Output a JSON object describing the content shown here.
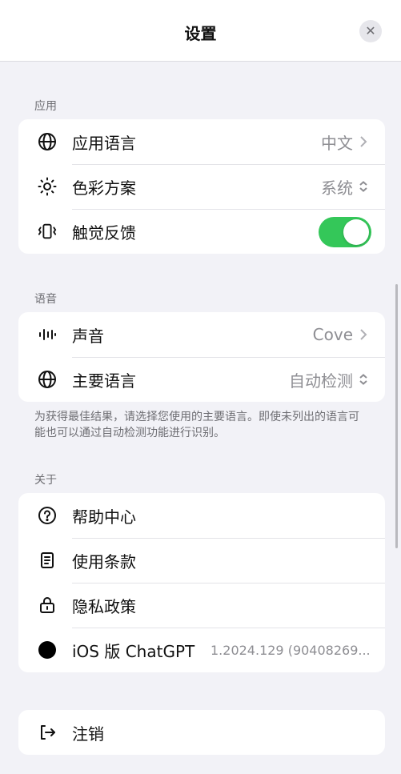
{
  "header": {
    "title": "设置"
  },
  "sections": {
    "app": {
      "label": "应用",
      "rows": [
        {
          "label": "应用语言",
          "value": "中文"
        },
        {
          "label": "色彩方案",
          "value": "系统"
        },
        {
          "label": "触觉反馈",
          "toggle_on": true
        }
      ]
    },
    "voice": {
      "label": "语音",
      "rows": [
        {
          "label": "声音",
          "value": "Cove"
        },
        {
          "label": "主要语言",
          "value": "自动检测"
        }
      ],
      "footnote": "为获得最佳结果，请选择您使用的主要语言。即使未列出的语言可能也可以通过自动检测功能进行识别。"
    },
    "about": {
      "label": "关于",
      "rows": [
        {
          "label": "帮助中心"
        },
        {
          "label": "使用条款"
        },
        {
          "label": "隐私政策"
        },
        {
          "label": "iOS 版 ChatGPT",
          "value": "1.2024.129 (90408269..."
        }
      ]
    },
    "account": {
      "rows": [
        {
          "label": "注销"
        }
      ]
    }
  },
  "colors": {
    "toggle_on": "#34c759",
    "background": "#f2f2f7",
    "card": "#ffffff"
  },
  "icons": [
    "globe-icon",
    "sun-icon",
    "haptics-icon",
    "waveform-icon",
    "globe-icon",
    "question-circle-icon",
    "document-icon",
    "lock-icon",
    "app-logo-icon",
    "logout-icon"
  ]
}
